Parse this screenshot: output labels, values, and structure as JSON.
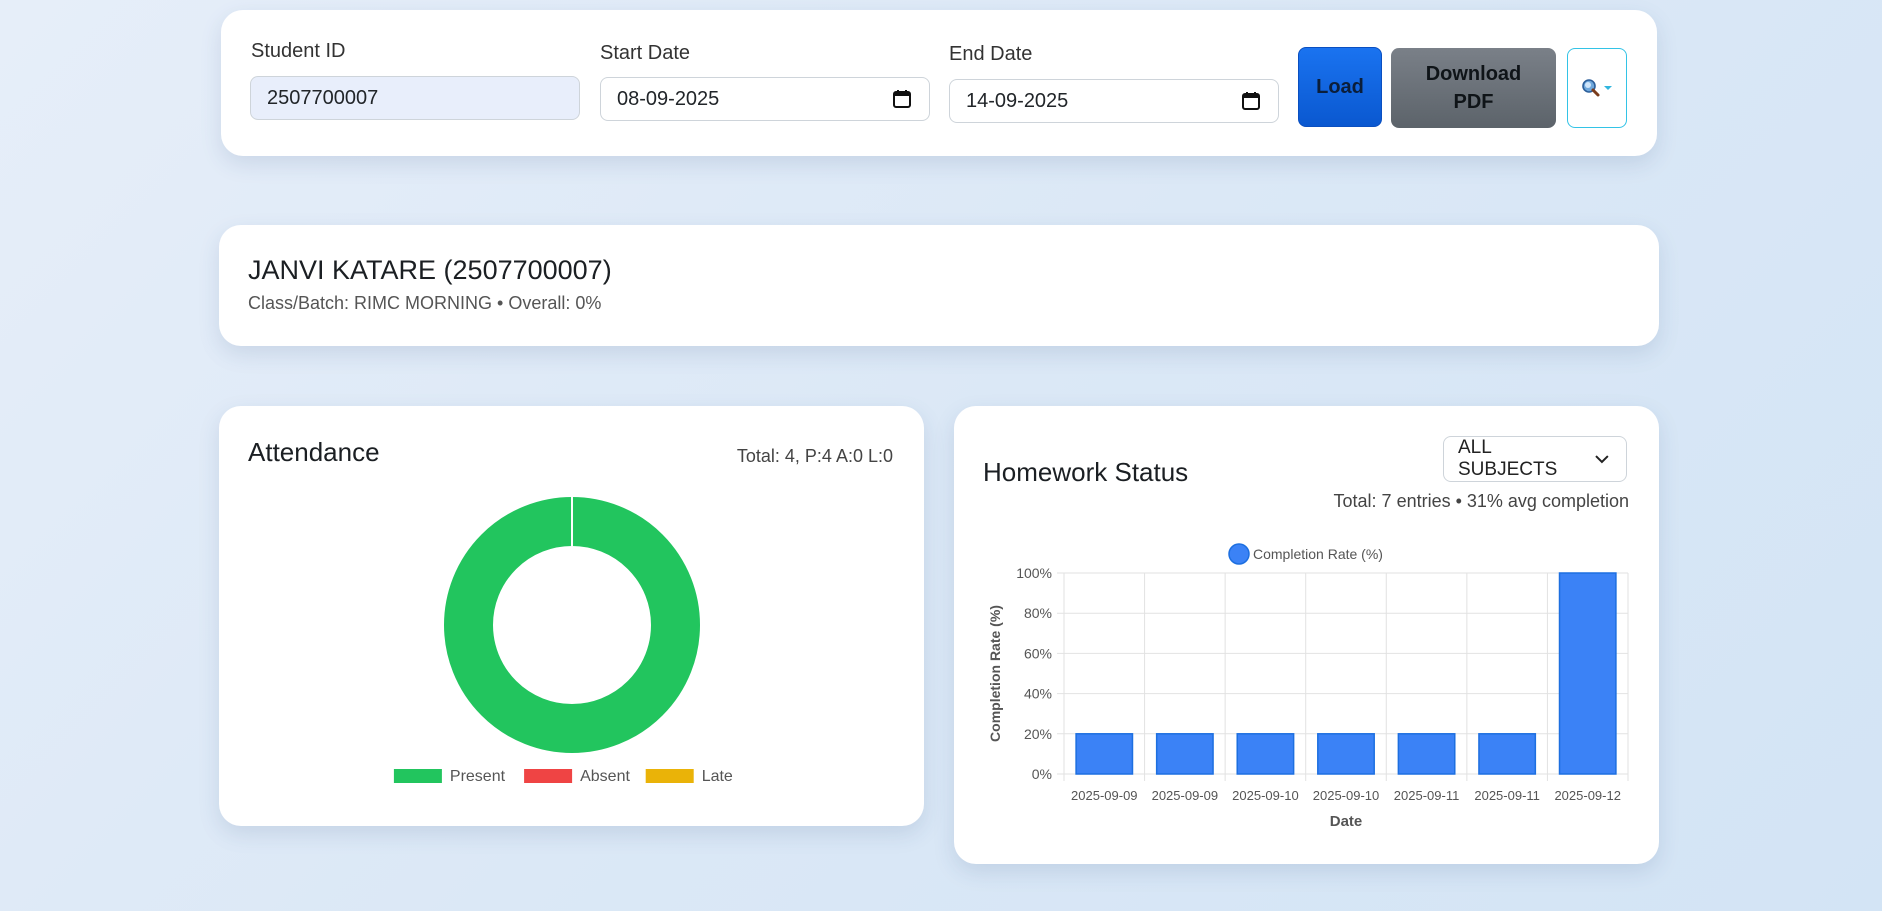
{
  "filters": {
    "student_id_label": "Student ID",
    "student_id_value": "2507700007",
    "start_date_label": "Start Date",
    "start_date_value": "08-09-2025",
    "end_date_label": "End Date",
    "end_date_value": "14-09-2025",
    "load_label": "Load",
    "pdf_label_line1": "Download",
    "pdf_label_line2": "PDF",
    "search_icon": "search-icon"
  },
  "student": {
    "name": "JANVI KATARE (2507700007)",
    "meta": "Class/Batch: RIMC MORNING • Overall: 0%"
  },
  "attendance": {
    "title": "Attendance",
    "summary": "Total: 4, P:4 A:0 L:0",
    "legend": [
      {
        "label": "Present",
        "color": "#22c55e"
      },
      {
        "label": "Absent",
        "color": "#ef4444"
      },
      {
        "label": "Late",
        "color": "#eab308"
      }
    ]
  },
  "homework": {
    "title": "Homework Status",
    "subject_select": "ALL SUBJECTS",
    "summary": "Total: 7 entries • 31% avg completion"
  },
  "chart_data": [
    {
      "type": "pie",
      "subtype": "doughnut",
      "labels": [
        "Present",
        "Absent",
        "Late"
      ],
      "values": [
        4,
        0,
        0
      ],
      "colors": [
        "#22c55e",
        "#ef4444",
        "#eab308"
      ],
      "legend_position": "bottom"
    },
    {
      "type": "bar",
      "categories": [
        "2025-09-09",
        "2025-09-09",
        "2025-09-10",
        "2025-09-10",
        "2025-09-11",
        "2025-09-11",
        "2025-09-12"
      ],
      "series": [
        {
          "name": "Completion Rate (%)",
          "values": [
            20,
            20,
            20,
            20,
            20,
            20,
            100
          ],
          "color": "#3b82f6"
        }
      ],
      "xlabel": "Date",
      "ylabel": "Completion Rate (%)",
      "ylim": [
        0,
        100
      ],
      "yticks": [
        "0%",
        "20%",
        "40%",
        "60%",
        "80%",
        "100%"
      ],
      "grid": true,
      "legend_position": "top"
    }
  ]
}
